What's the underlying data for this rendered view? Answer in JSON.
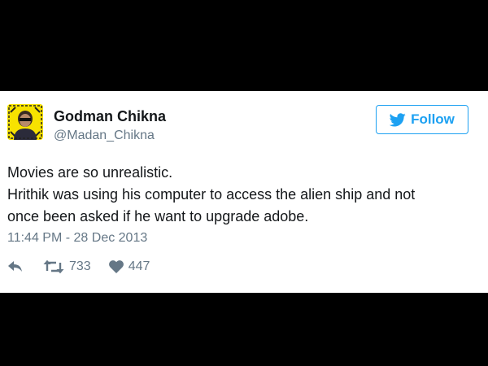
{
  "tweet": {
    "author_name": "Godman Chikna",
    "author_handle": "@Madan_Chikna",
    "follow_label": "Follow",
    "text_lines": [
      "Movies are so unrealistic.",
      "Hrithik was using his computer to access the alien ship and not",
      "once been asked if he want to upgrade adobe."
    ],
    "timestamp": "11:44 PM - 28 Dec 2013",
    "retweet_count": "733",
    "like_count": "447"
  },
  "icons": {
    "reply": "reply-icon",
    "retweet": "retweet-icon",
    "like": "heart-icon",
    "follow": "twitter-bird-icon"
  },
  "colors": {
    "accent": "#1da1f2",
    "text": "#14171a",
    "muted": "#657786",
    "avatar_bg": "#f7e200",
    "background": "#000000"
  }
}
